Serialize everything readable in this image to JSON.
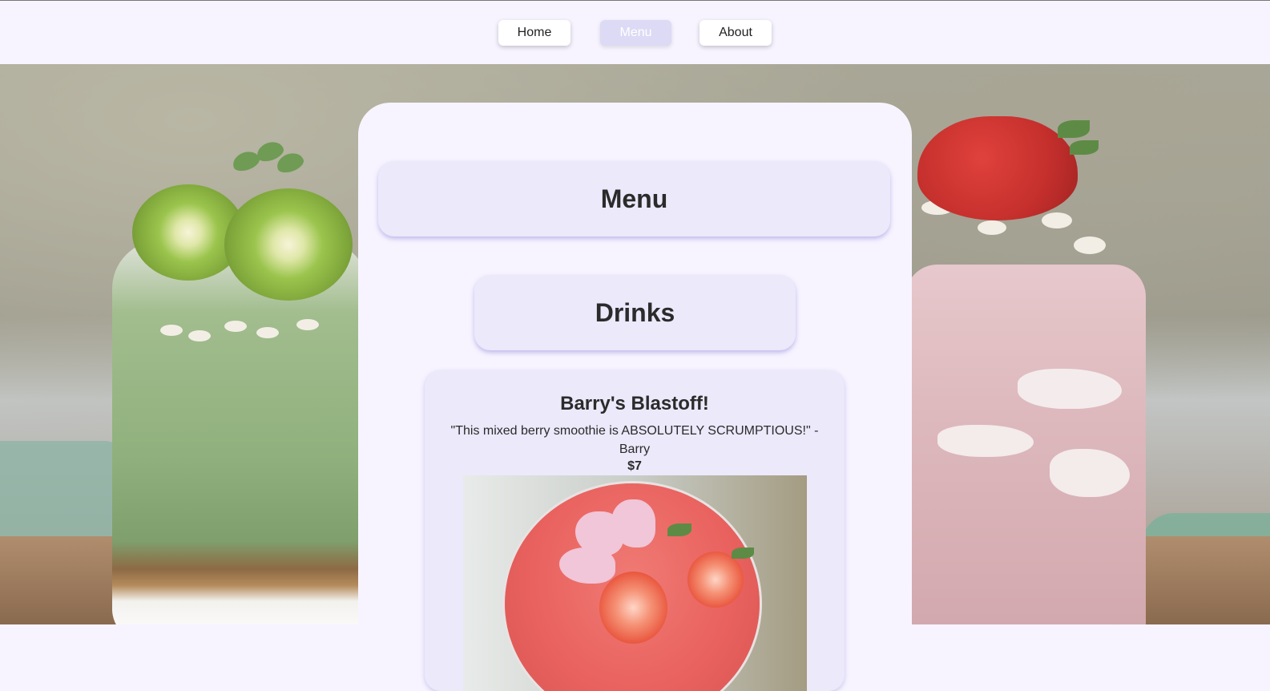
{
  "nav": {
    "items": [
      {
        "label": "Home",
        "active": false
      },
      {
        "label": "Menu",
        "active": true
      },
      {
        "label": "About",
        "active": false
      }
    ]
  },
  "main": {
    "heading": "Menu",
    "sections": [
      {
        "heading": "Drinks",
        "items": [
          {
            "title": "Barry's Blastoff!",
            "quote": "\"This mixed berry smoothie is ABSOLUTELY SCRUMPTIOUS!\" - Barry",
            "price": "$7"
          }
        ]
      }
    ]
  },
  "colors": {
    "nav_background": "#f7f4ff",
    "active_nav": "#dcdaf5",
    "card_background": "#ebe9fa"
  }
}
